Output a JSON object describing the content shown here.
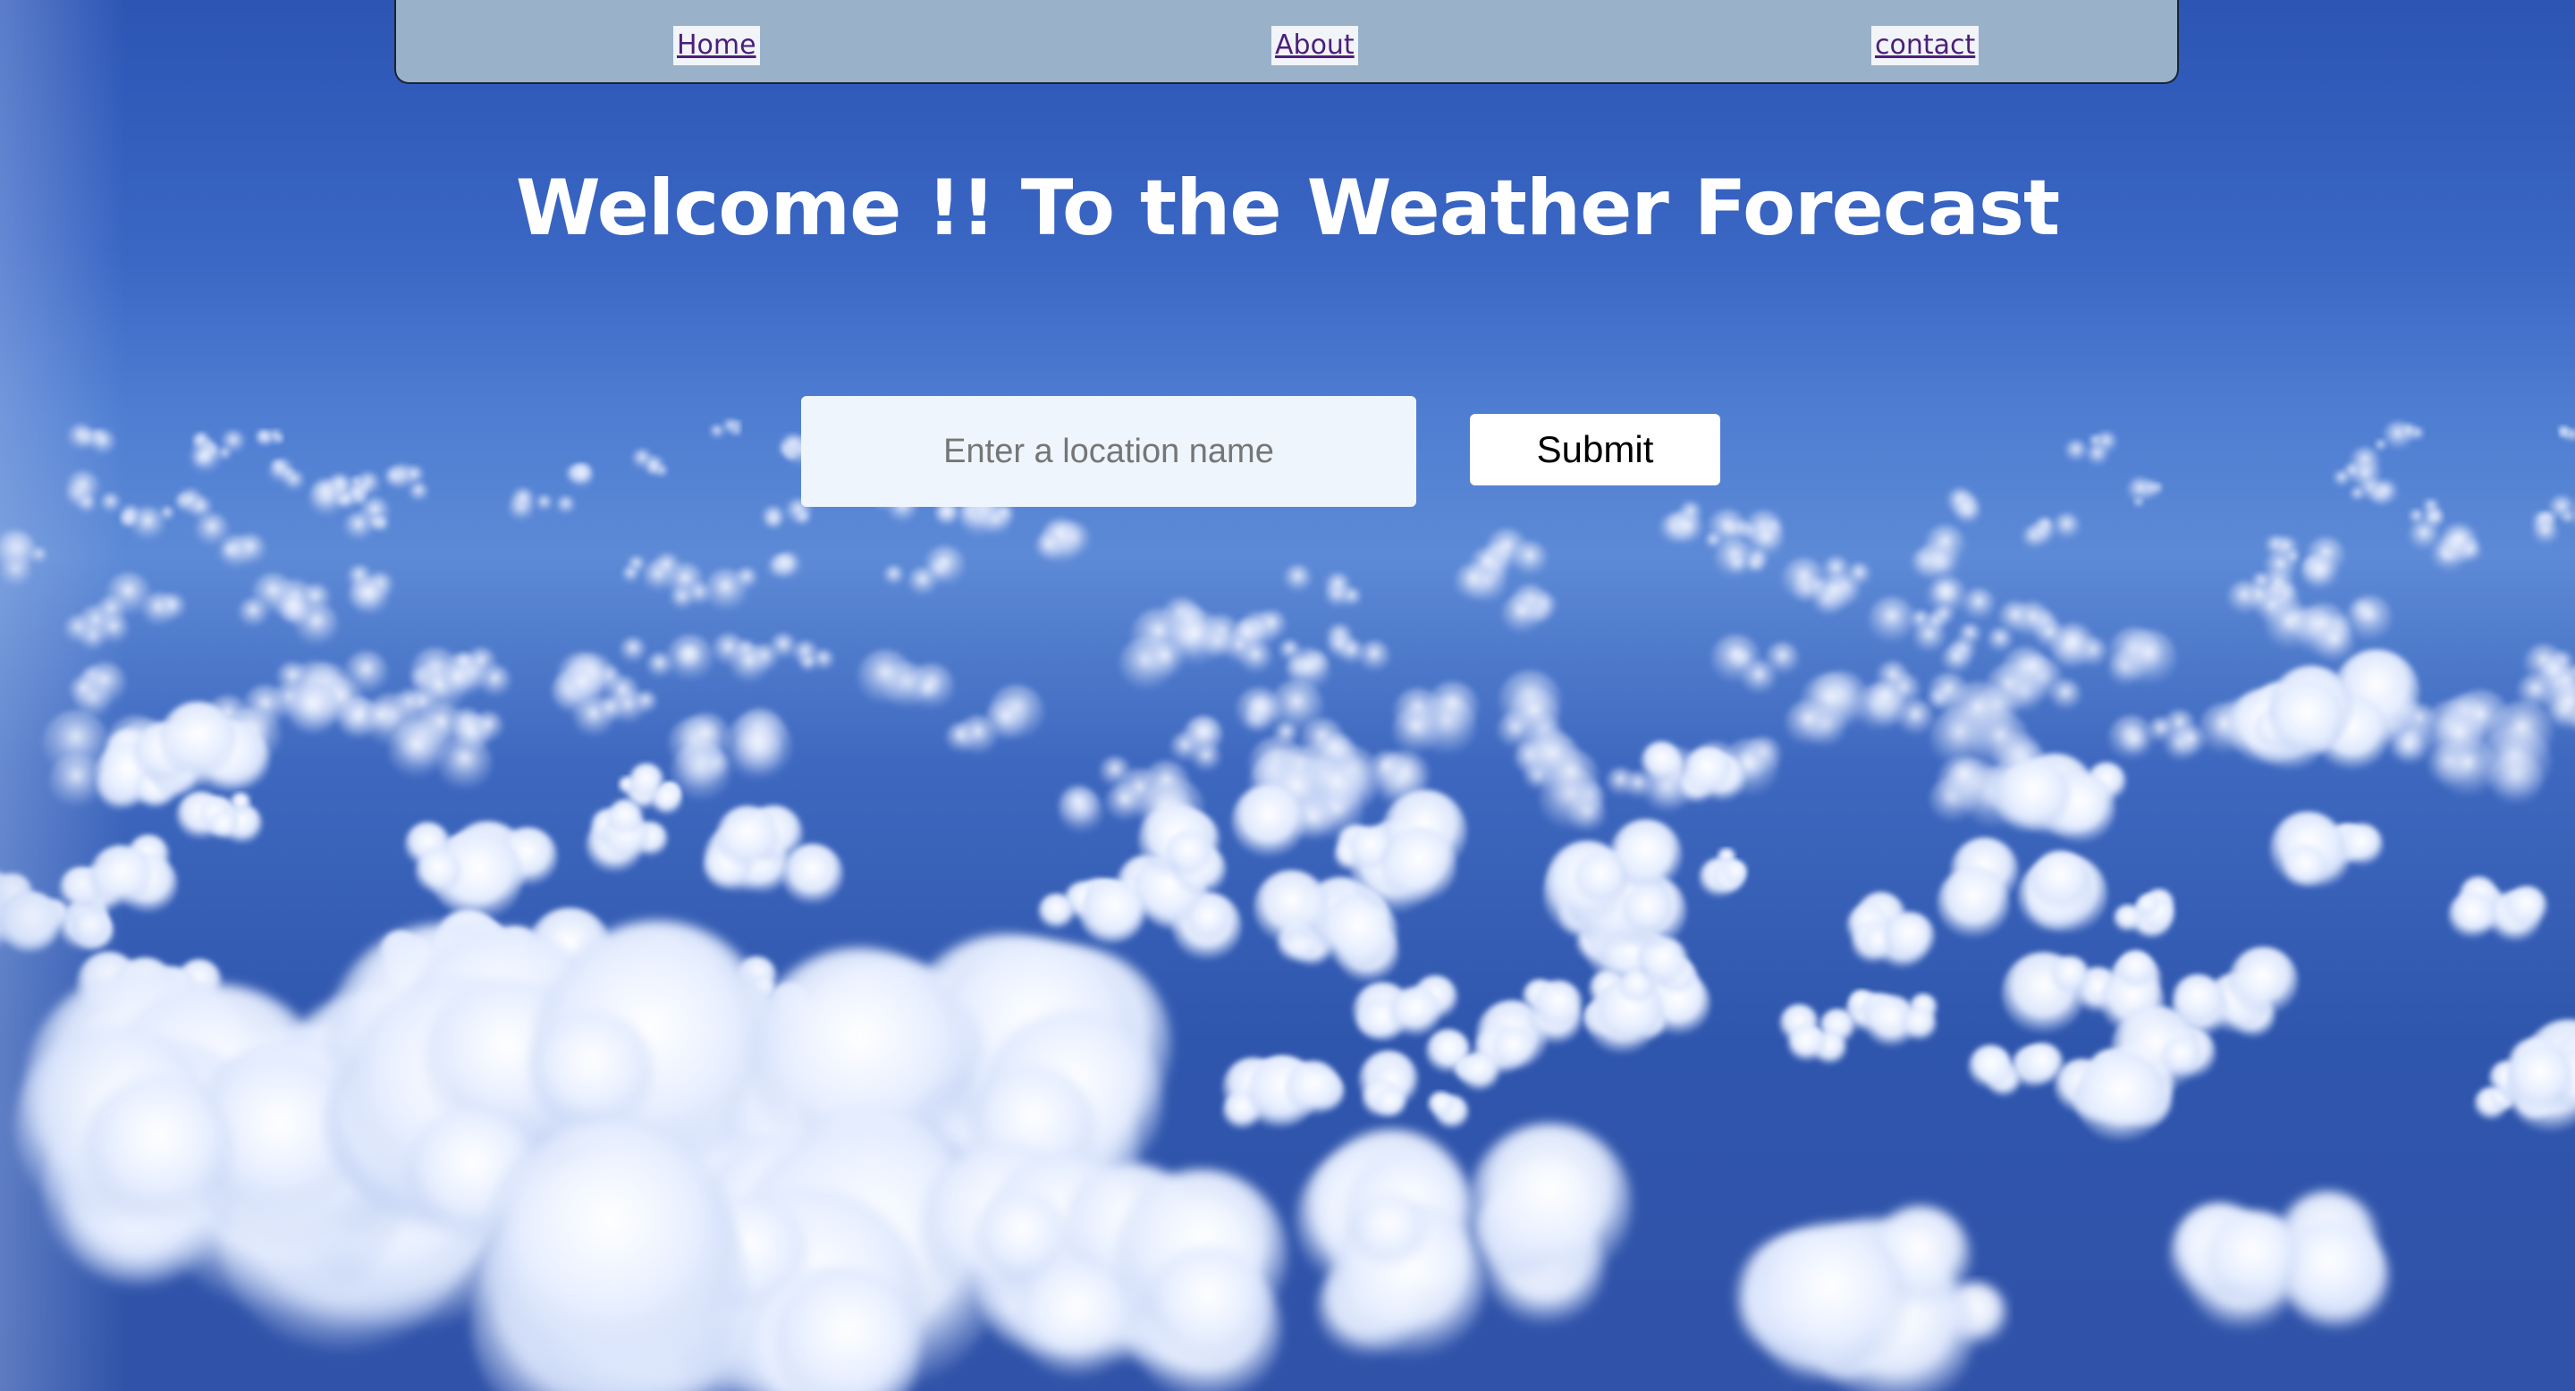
{
  "nav": {
    "items": [
      {
        "label": "Home"
      },
      {
        "label": "About"
      },
      {
        "label": "contact"
      }
    ]
  },
  "hero": {
    "title": "Welcome !! To the Weather Forecast"
  },
  "search": {
    "placeholder": "Enter a location name",
    "value": "",
    "submit_label": "Submit"
  },
  "colors": {
    "navbar_bg": "#99b2ca",
    "link": "#4c1f7a",
    "sky_top": "#2c55b4",
    "sky_bottom": "#3052a8",
    "input_bg": "#eef5fc",
    "button_bg": "#ffffff"
  },
  "background": {
    "icon": "clouds-sky-photo"
  }
}
